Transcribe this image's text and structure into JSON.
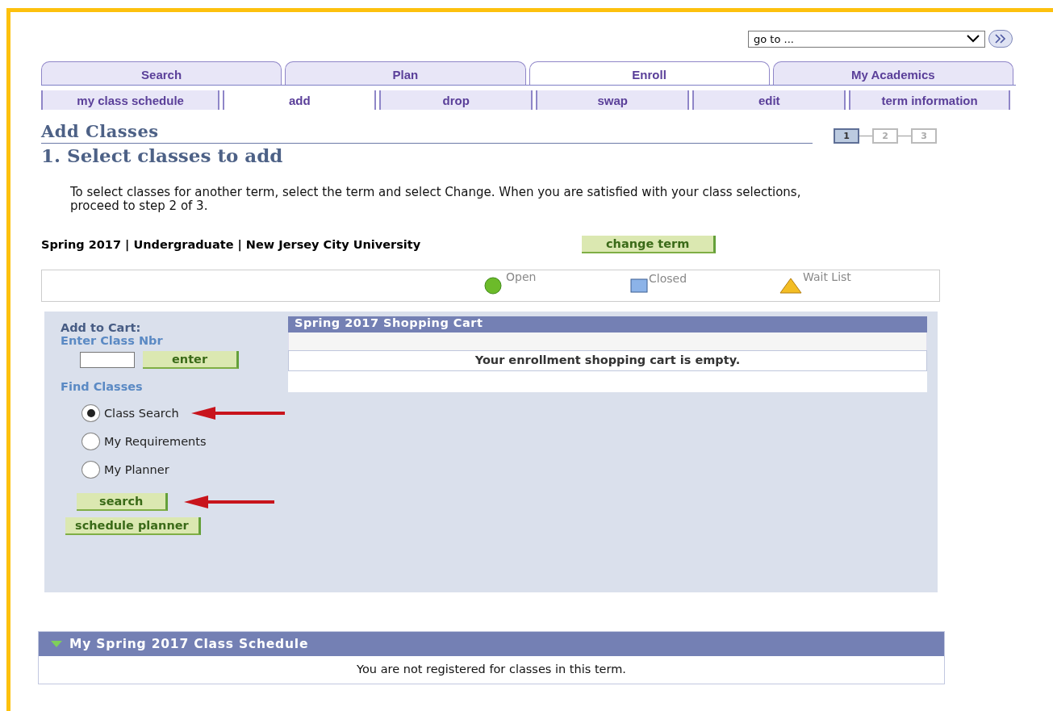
{
  "goto": {
    "value": "go to ..."
  },
  "tabs": [
    {
      "label": "Search",
      "selected": false
    },
    {
      "label": "Plan",
      "selected": false
    },
    {
      "label": "Enroll",
      "selected": true
    },
    {
      "label": "My Academics",
      "selected": false
    }
  ],
  "subtabs": [
    {
      "label": "my class schedule",
      "selected": false
    },
    {
      "label": "add",
      "selected": true
    },
    {
      "label": "drop",
      "selected": false
    },
    {
      "label": "swap",
      "selected": false
    },
    {
      "label": "edit",
      "selected": false
    },
    {
      "label": "term information",
      "selected": false
    }
  ],
  "page_title": "Add Classes",
  "steps": [
    {
      "label": "1",
      "selected": true
    },
    {
      "label": "2",
      "selected": false
    },
    {
      "label": "3",
      "selected": false
    }
  ],
  "step_title": "1.  Select classes to add",
  "instructions": "To select classes for another term, select the term and select Change.  When you are satisfied with your class selections, proceed to step 2 of 3.",
  "term": "Spring 2017 | Undergraduate | New Jersey City University",
  "change_term": "change term",
  "legend": [
    {
      "kind": "open",
      "label": "Open"
    },
    {
      "kind": "closed",
      "label": "Closed"
    },
    {
      "kind": "waitlist",
      "label": "Wait List"
    }
  ],
  "add_to_cart": {
    "title": "Add to Cart:",
    "class_nbr_label": "Enter Class Nbr",
    "enter_button": "enter",
    "find_label": "Find Classes",
    "options": [
      {
        "label": "Class Search",
        "selected": true,
        "arrow": true
      },
      {
        "label": "My Requirements",
        "selected": false,
        "arrow": false
      },
      {
        "label": "My Planner",
        "selected": false,
        "arrow": false
      }
    ],
    "search_button": "search",
    "search_arrow": true,
    "planner_button": "schedule planner"
  },
  "cart": {
    "title": "Spring 2017 Shopping Cart",
    "message": "Your enrollment shopping cart is empty."
  },
  "schedule": {
    "title": "My Spring 2017 Class Schedule",
    "expanded": true,
    "message": "You are not registered for classes in this term."
  }
}
